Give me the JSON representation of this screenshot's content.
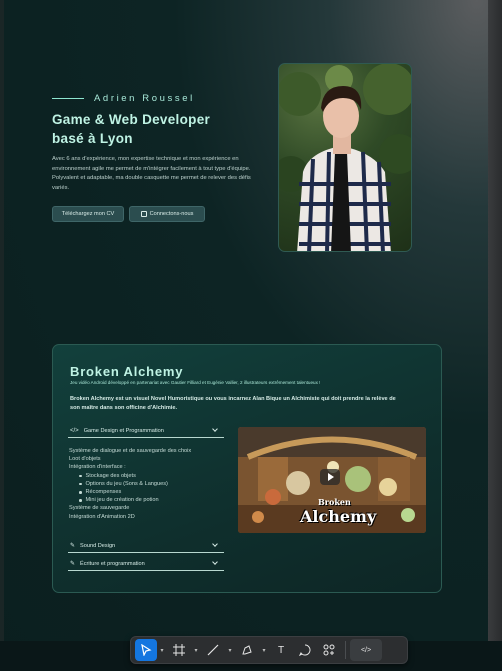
{
  "hero": {
    "name": "Adrien Roussel",
    "title_line1": "Game & Web Developer",
    "title_line2": "basé à Lyon",
    "description": "Avec 6 ans d'expérience, mon expertise technique et mon expérience en environnement agile me permet de m'intégrer facilement à tout type d'équipe. Polyvalent et adaptable, ma double casquette me permet de relever des défis variés.",
    "cv_button": "Téléchargez mon CV",
    "connect_button": "Connectons-nous"
  },
  "project": {
    "title": "Broken Alchemy",
    "subtitle": "Jeu vidéo Android développé en partenariat avec Gautier Filliard et Eugénie Vallier, 2 illustrateurs extrêmement talentueux !",
    "description": "Broken Alchemy est un visuel Novel Humoristique ou vous incarnez Alan Bique un Alchimiste qui doit prendre la relève de son maître dans son officine d'Alchimie.",
    "accordions": [
      {
        "label": "Game Design et Programmation",
        "icon": "code-icon"
      },
      {
        "label": "Sound Design",
        "icon": "wrench-icon"
      },
      {
        "label": "Écriture et programmation",
        "icon": "wrench-icon"
      }
    ],
    "details": [
      "Système de dialogue et de sauvegarde des choix",
      "Loot d'objets",
      "Intégration d'interface :"
    ],
    "bullets": [
      "Stockage des objets",
      "Options du jeu (Sons & Langues)",
      "Récompenses",
      "Mini jeu de création de potion"
    ],
    "details_after": [
      "Système de sauvegarde",
      "Intégration d'Animation 2D"
    ],
    "video_logo_line1": "Broken",
    "video_logo_line2": "Alchemy"
  },
  "toolbar": {
    "tools": [
      "select-tool",
      "frame-tool",
      "line-tool",
      "pen-tool",
      "text-tool",
      "comment-tool",
      "components-tool",
      "code-tool"
    ],
    "text_label": "T",
    "code_label": "</>"
  },
  "colors": {
    "accent": "#bff3e4",
    "select_blue": "#1476e0"
  }
}
